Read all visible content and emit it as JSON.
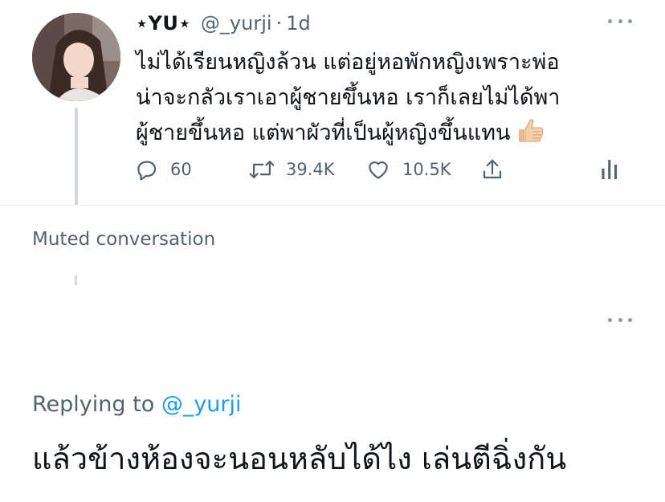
{
  "tweet": {
    "display_name": "⋆YU⋆",
    "handle": "@_yurji",
    "separator": "·",
    "time": "1d",
    "text_lines": [
      "ไม่ได้เรียนหญิงล้วน แต่อยู่หอพักหญิงเพราะพ่อ",
      "น่าจะกลัวเราเอาผู้ชายขึ้นหอ เราก็เลยไม่ได้พา",
      "ผู้ชายขึ้นหอ แต่พาผัวที่เป็นผู้หญิงขึ้นแทน"
    ],
    "emoji_icon": "thumbs-up-icon",
    "replies": "60",
    "retweets": "39.4K",
    "likes": "10.5K",
    "icons": {
      "reply": "reply-icon",
      "retweet": "retweet-icon",
      "like": "heart-icon",
      "share": "share-icon",
      "analytics": "analytics-icon",
      "more": "more-icon"
    }
  },
  "muted": {
    "label": "Muted conversation"
  },
  "reply": {
    "replying_prefix": "Replying to",
    "replying_handle": "@_yurji",
    "text": "แล้วข้างห้องจะนอนหลับได้ไง เล่นตีฉิ่งกัน"
  },
  "colors": {
    "text": "#0f1419",
    "secondary": "#536471",
    "accent": "#1d9bf0",
    "divider": "#e6ecf0"
  }
}
